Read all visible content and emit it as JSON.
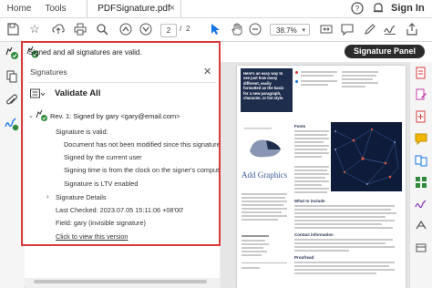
{
  "tabs": {
    "home": "Home",
    "tools": "Tools",
    "document": "PDFSignature.pdf",
    "close": "×",
    "sign_in": "Sign In"
  },
  "toolbar": {
    "page_current": "2",
    "page_separator": "/",
    "page_total": "2",
    "zoom": "38.7%"
  },
  "signature_bar": {
    "status": "Signed and all signatures are valid.",
    "panel_button": "Signature Panel"
  },
  "signatures_panel": {
    "title": "Signatures",
    "validate_all": "Validate All",
    "revision": "Rev. 1: Signed by gary <gary@email.com>",
    "details": [
      "Signature is valid:",
      "Document has not been modified since this signature was",
      "Signed by the current user",
      "Signing time is from the clock on the signer's computer.",
      "Signature is LTV enabled"
    ],
    "signature_details": "Signature Details",
    "last_checked": "Last Checked: 2023.07.05 15:11:06 +08'00'",
    "field": "Field: gary (invisible signature)",
    "view_version": "Click to view this version"
  },
  "document_preview": {
    "headline": "Here's an easy way to see just how many different, easily formatted as the basis for a new paragraph, character, or list style.",
    "section_fonts": "Fonts",
    "section_add_graphics": "Add Graphics",
    "section_include": "What to include",
    "section_contact": "Contact information",
    "section_proofread": "Proofread"
  },
  "colors": {
    "accent_red": "#d83a3a",
    "valid_green": "#2e8b3a",
    "active_blue": "#1473e6",
    "navy": "#1f2d4d"
  }
}
